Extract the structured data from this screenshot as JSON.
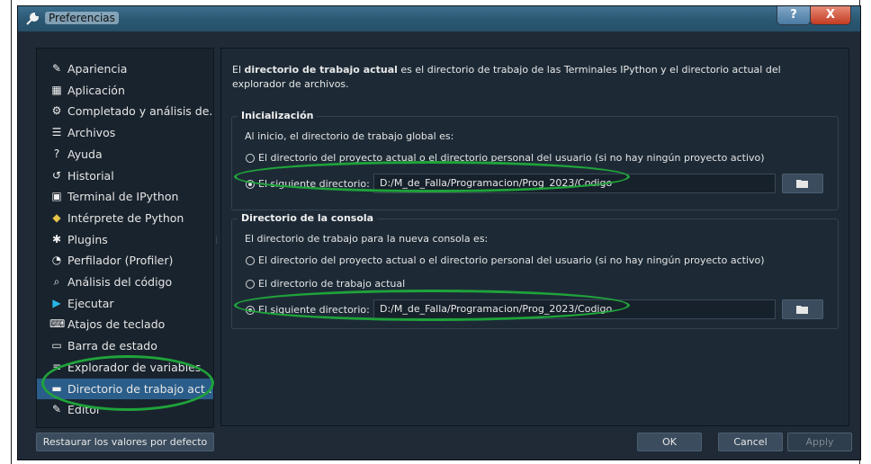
{
  "window": {
    "title": "Preferencias",
    "help_glyph": "?",
    "close_glyph": "X"
  },
  "sidebar": {
    "items": [
      {
        "label": "Apariencia",
        "icon": "paintbrush-icon"
      },
      {
        "label": "Aplicación",
        "icon": "application-icon"
      },
      {
        "label": "Completado y análisis de...",
        "icon": "completion-icon"
      },
      {
        "label": "Archivos",
        "icon": "files-icon"
      },
      {
        "label": "Ayuda",
        "icon": "help-icon"
      },
      {
        "label": "Historial",
        "icon": "history-icon"
      },
      {
        "label": "Terminal de IPython",
        "icon": "terminal-icon"
      },
      {
        "label": "Intérprete de Python",
        "icon": "python-icon"
      },
      {
        "label": "Plugins",
        "icon": "puzzle-icon"
      },
      {
        "label": "Perfilador (Profiler)",
        "icon": "stopwatch-icon"
      },
      {
        "label": "Análisis del código",
        "icon": "code-analysis-icon"
      },
      {
        "label": "Ejecutar",
        "icon": "run-icon"
      },
      {
        "label": "Atajos de teclado",
        "icon": "keyboard-icon"
      },
      {
        "label": "Barra de estado",
        "icon": "statusbar-icon"
      },
      {
        "label": "Explorador de variables",
        "icon": "variable-explorer-icon"
      },
      {
        "label": "Directorio de trabajo act...",
        "icon": "folder-icon",
        "active": true
      },
      {
        "label": "Editor",
        "icon": "editor-icon"
      }
    ]
  },
  "content": {
    "desc_bold": "directorio de trabajo actual",
    "desc_pre": "El ",
    "desc_post": " es el directorio de trabajo de las Terminales IPython y el directorio actual del explorador de archivos.",
    "init": {
      "title": "Inicialización",
      "intro": "Al inicio, el directorio de trabajo global es:",
      "option1": "El directorio del proyecto actual o el directorio personal del usuario (si no hay ningún proyecto activo)",
      "option2": "El siguiente directorio:",
      "path": "D:/M_de_Falla/Programacion/Prog_2023/Codigo",
      "selected": "option2"
    },
    "console": {
      "title": "Directorio de la consola",
      "intro": "El directorio de trabajo para la nueva consola es:",
      "option1": "El directorio del proyecto actual o el directorio personal del usuario (si no hay ningún proyecto activo)",
      "option2": "El directorio de trabajo actual",
      "option3": "El siguiente directorio:",
      "path": "D:/M_de_Falla/Programacion/Prog_2023/Codigo",
      "selected": "option3"
    }
  },
  "footer": {
    "reset": "Restaurar los valores por defecto",
    "ok": "OK",
    "cancel": "Cancel",
    "apply": "Apply"
  },
  "colors": {
    "highlight_ellipse": "#1fa33a",
    "active_item": "#2a5d8a",
    "background": "#1d2a36"
  }
}
